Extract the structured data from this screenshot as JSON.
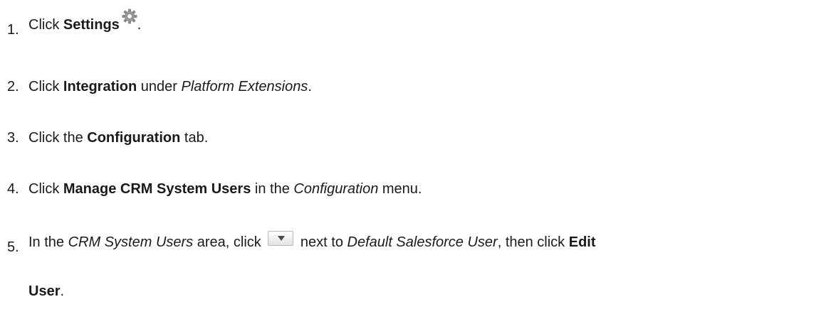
{
  "steps": [
    {
      "num": "1.",
      "pre": "Click ",
      "bold": "Settings",
      "post": "."
    },
    {
      "num": "2.",
      "pre": "Click ",
      "bold": "Integration",
      "mid": " under ",
      "italic": "Platform Extensions",
      "post": "."
    },
    {
      "num": "3.",
      "pre": "Click the ",
      "bold": "Configuration",
      "post": " tab."
    },
    {
      "num": "4.",
      "pre": "Click ",
      "bold": "Manage CRM System Users",
      "mid": " in the ",
      "italic": "Configuration",
      "post": " menu."
    },
    {
      "num": "5.",
      "pre": "In the ",
      "italic1": "CRM System Users",
      "mid1": " area, click ",
      "mid2": " next to ",
      "italic2": "Default Salesforce User",
      "mid3": ", then click ",
      "bold1": "Edit",
      "bold2": "User",
      "post": "."
    }
  ],
  "icons": {
    "settings": "gear-icon",
    "dropdown": "dropdown-arrow-icon"
  },
  "colors": {
    "gear": "#8a8a8a",
    "button_border": "#b8b8b8"
  }
}
